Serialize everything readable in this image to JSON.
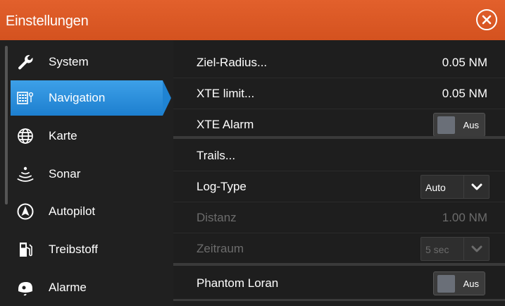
{
  "window": {
    "title": "Einstellungen",
    "close_icon": "close-circle-icon"
  },
  "sidebar": {
    "items": [
      {
        "label": "System",
        "icon": "wrench-icon"
      },
      {
        "label": "Navigation",
        "icon": "navigation-icon",
        "active": true
      },
      {
        "label": "Karte",
        "icon": "globe-icon"
      },
      {
        "label": "Sonar",
        "icon": "sonar-icon"
      },
      {
        "label": "Autopilot",
        "icon": "autopilot-icon"
      },
      {
        "label": "Treibstoff",
        "icon": "fuel-icon"
      },
      {
        "label": "Alarme",
        "icon": "alarm-icon"
      }
    ]
  },
  "settings": {
    "ziel_radius": {
      "label": "Ziel-Radius...",
      "value": "0.05 NM"
    },
    "xte_limit": {
      "label": "XTE limit...",
      "value": "0.05 NM"
    },
    "xte_alarm": {
      "label": "XTE Alarm",
      "toggle": "Aus"
    },
    "trails": {
      "label": "Trails..."
    },
    "log_type": {
      "label": "Log-Type",
      "value": "Auto"
    },
    "distanz": {
      "label": "Distanz",
      "value": "1.00 NM"
    },
    "zeitraum": {
      "label": "Zeitraum",
      "value": "5 sec"
    },
    "phantom_loran": {
      "label": "Phantom Loran",
      "toggle": "Aus"
    }
  },
  "colors": {
    "title_bar": "#d9562a",
    "active_item": "#1f83d2",
    "background": "#1e1e1e"
  }
}
